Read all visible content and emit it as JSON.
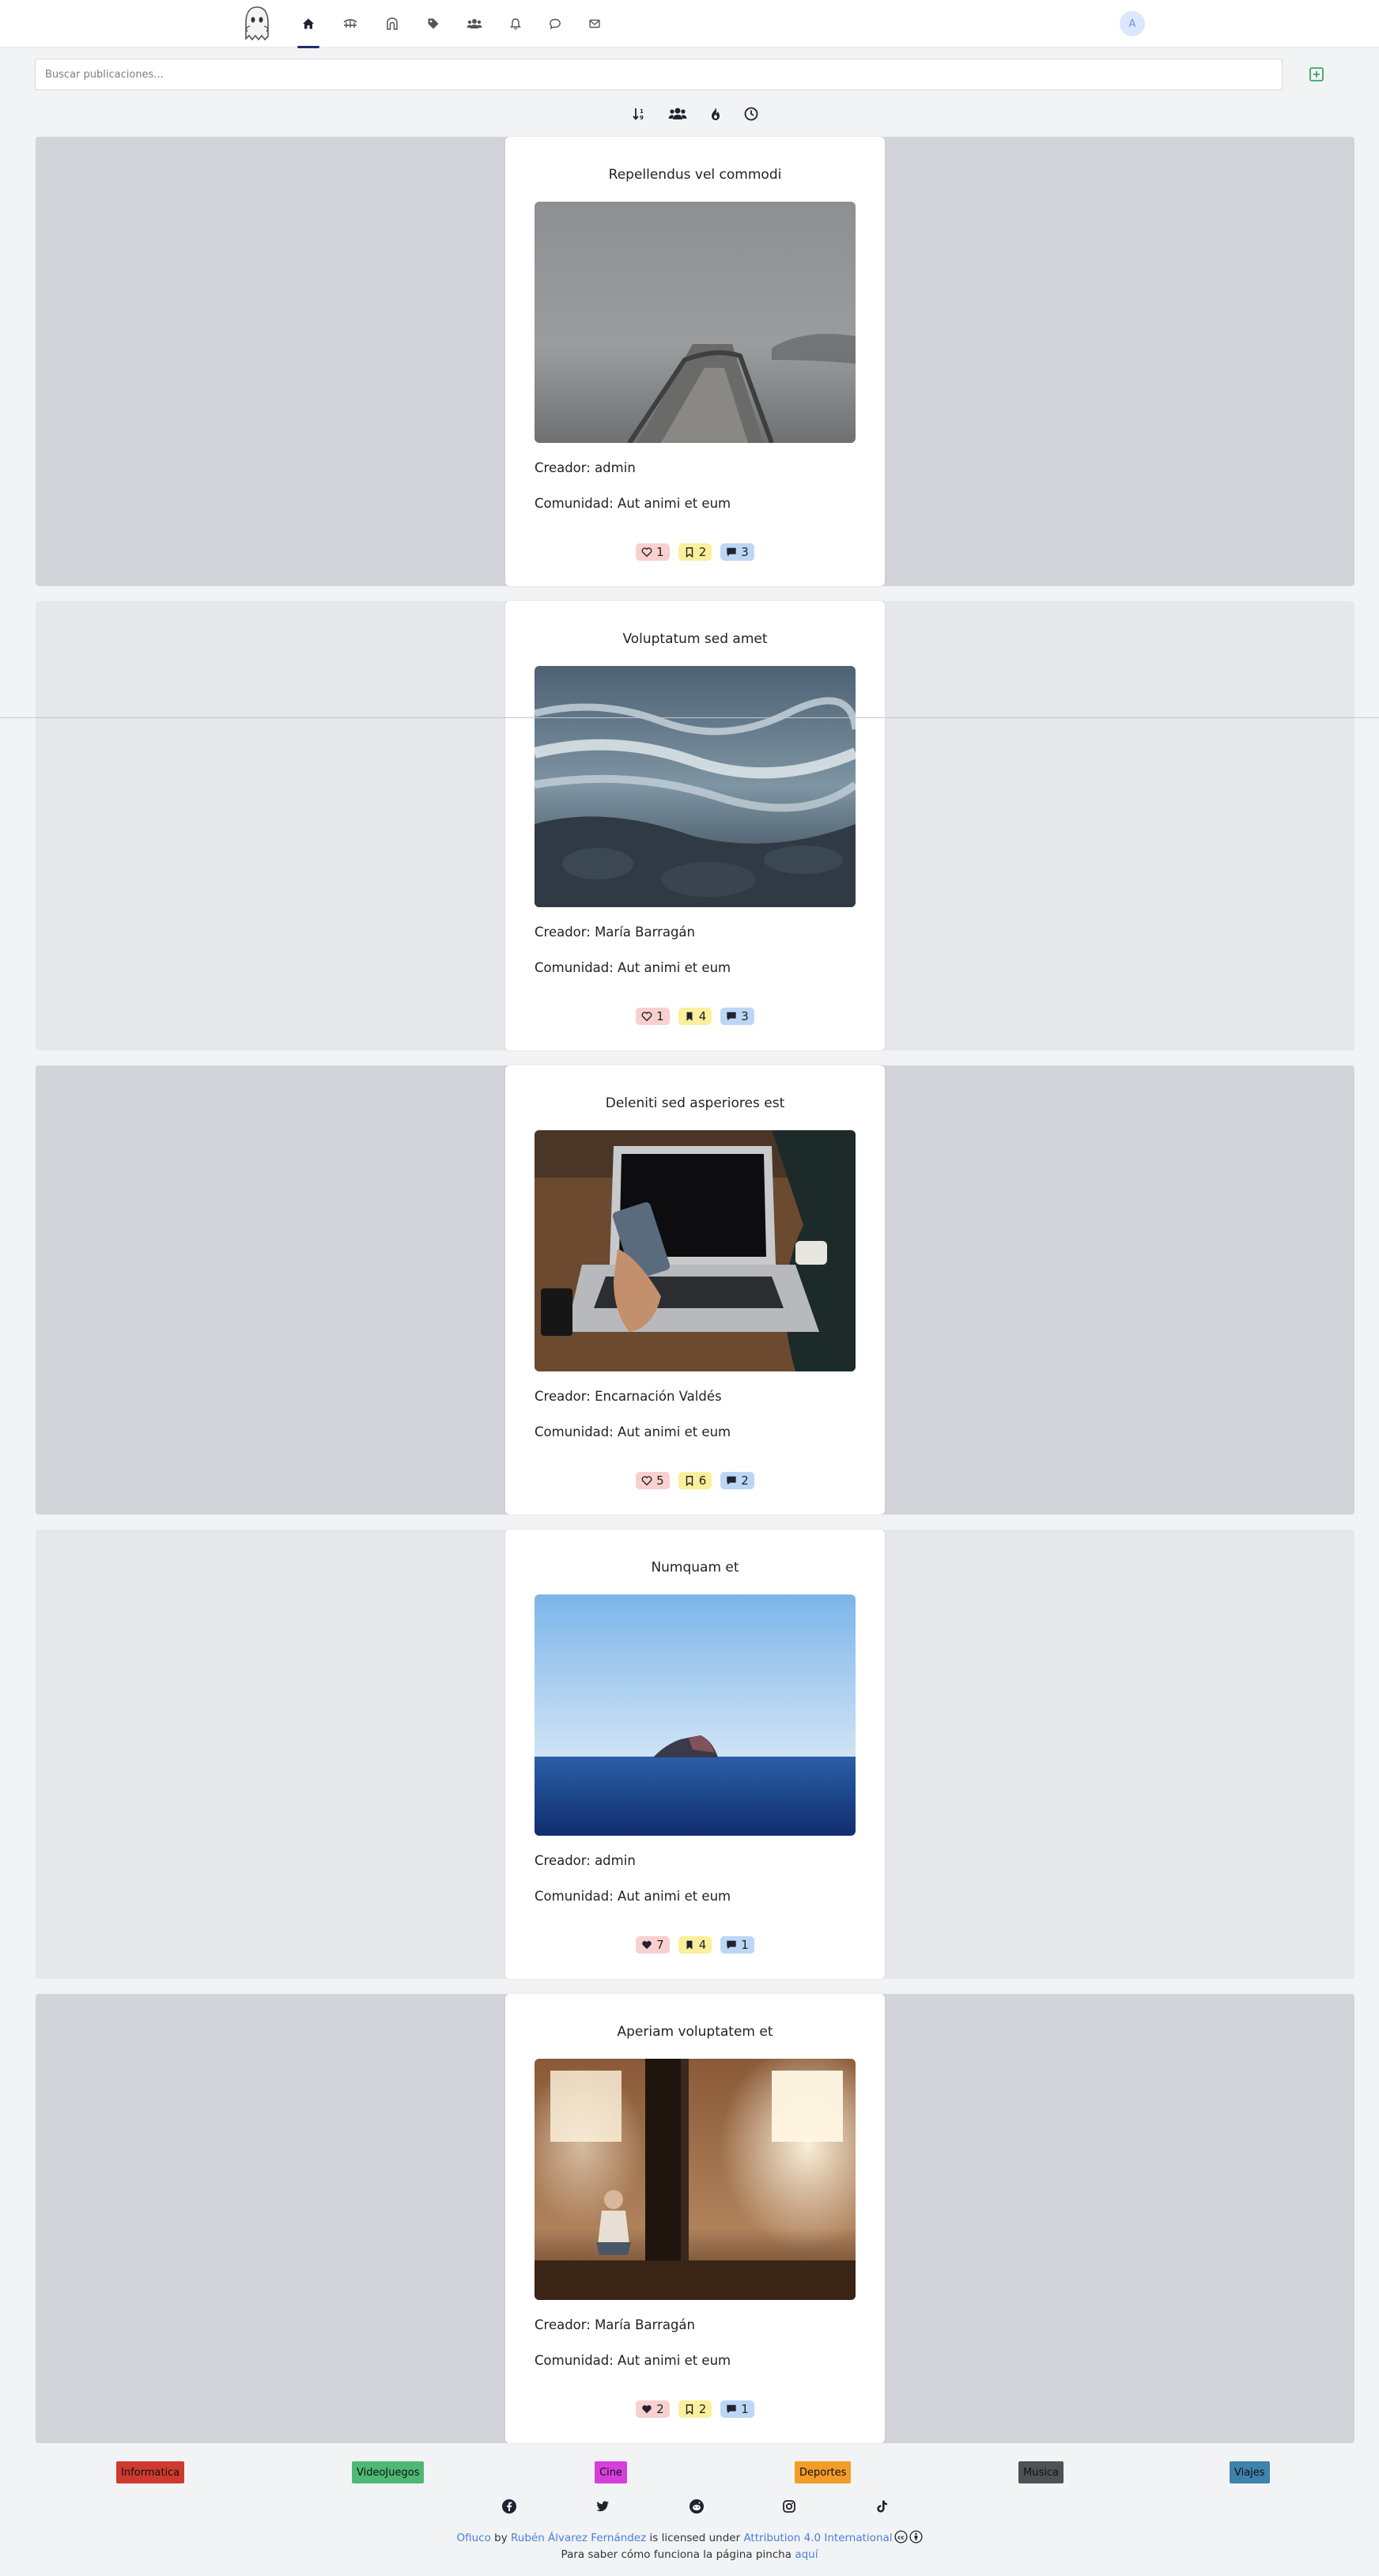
{
  "search": {
    "placeholder": "Buscar publicaciones..."
  },
  "user": {
    "avatar_initial": "A"
  },
  "nav": {
    "items": [
      {
        "icon": "home-icon",
        "active": true
      },
      {
        "icon": "bridge-icon",
        "active": false
      },
      {
        "icon": "archway-icon",
        "active": false
      },
      {
        "icon": "tags-icon",
        "active": false
      },
      {
        "icon": "users-icon",
        "active": false
      },
      {
        "icon": "bell-icon",
        "active": false
      },
      {
        "icon": "chat-icon",
        "active": false
      },
      {
        "icon": "envelope-icon",
        "active": false
      }
    ]
  },
  "filters": [
    {
      "icon": "sort-icon"
    },
    {
      "icon": "people-icon"
    },
    {
      "icon": "fire-icon"
    },
    {
      "icon": "clock-icon"
    }
  ],
  "posts": [
    {
      "title": "Repellendus vel commodi",
      "creator": "Creador: admin",
      "community": "Comunidad: Aut animi et eum",
      "likes": "1",
      "liked": false,
      "saves": "2",
      "saved": false,
      "comments": "3",
      "image": "foggy-pier-photo"
    },
    {
      "title": "Voluptatum sed amet",
      "creator": "Creador: María Barragán",
      "community": "Comunidad: Aut animi et eum",
      "likes": "1",
      "liked": false,
      "saves": "4",
      "saved": true,
      "comments": "3",
      "image": "ocean-waves-photo"
    },
    {
      "title": "Deleniti sed asperiores est",
      "creator": "Creador: Encarnación Valdés",
      "community": "Comunidad: Aut animi et eum",
      "likes": "5",
      "liked": false,
      "saves": "6",
      "saved": false,
      "comments": "2",
      "image": "laptop-phone-photo"
    },
    {
      "title": "Numquam et",
      "creator": "Creador: admin",
      "community": "Comunidad: Aut animi et eum",
      "likes": "7",
      "liked": true,
      "saves": "4",
      "saved": true,
      "comments": "1",
      "image": "sea-island-photo"
    },
    {
      "title": "Aperiam voluptatem et",
      "creator": "Creador: María Barragán",
      "community": "Comunidad: Aut animi et eum",
      "likes": "2",
      "liked": true,
      "saves": "2",
      "saved": false,
      "comments": "1",
      "image": "warehouse-light-photo"
    }
  ],
  "categories": [
    {
      "label": "Informatica",
      "color": "#cf3a2e"
    },
    {
      "label": "VideoJuegos",
      "color": "#4db974"
    },
    {
      "label": "Cine",
      "color": "#d63fdc"
    },
    {
      "label": "Deportes",
      "color": "#f39c29"
    },
    {
      "label": "Musica",
      "color": "#4f5253"
    },
    {
      "label": "Viajes",
      "color": "#3f82ad"
    }
  ],
  "social": [
    "facebook-icon",
    "twitter-icon",
    "reddit-icon",
    "instagram-icon",
    "tiktok-icon"
  ],
  "footer": {
    "site_name": "Ofiuco",
    "by": "by",
    "author": "Rubén Álvarez Fernández",
    "licensed": "is licensed under",
    "license": "Attribution 4.0 International",
    "how_text": "Para saber cómo funciona la página pincha",
    "how_link": "aquí"
  },
  "colors": {
    "post_bg_dark": "#d2d4d9",
    "post_bg_light": "#e6e7ea",
    "like_badge": "#f8d0d0",
    "save_badge": "#fbef9c",
    "comment_badge": "#bcd7f6",
    "link": "#4a7fd8",
    "create_button": "#3aa567"
  }
}
